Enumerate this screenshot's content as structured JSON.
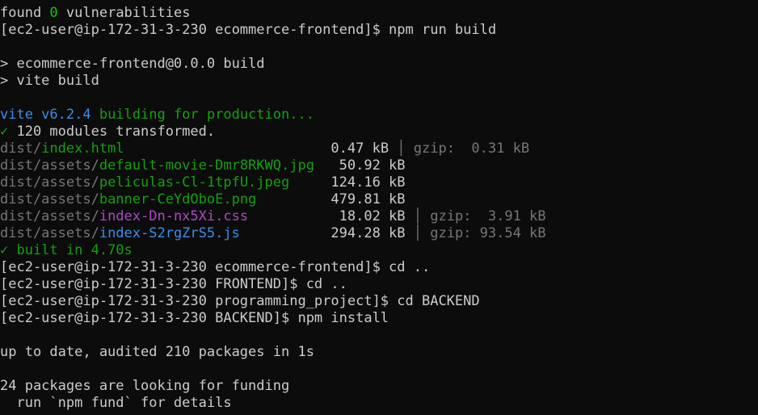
{
  "terminal": {
    "lines": [
      [
        {
          "t": "found ",
          "c": "white"
        },
        {
          "t": "0",
          "c": "bright-green"
        },
        {
          "t": " vulnerabilities",
          "c": "white"
        }
      ],
      [
        {
          "t": "[ec2-user@ip-172-31-3-230 ecommerce-frontend]$ npm run build",
          "c": "white"
        }
      ],
      [],
      [
        {
          "t": "> ecommerce-frontend@0.0.0 build",
          "c": "white"
        }
      ],
      [
        {
          "t": "> vite build",
          "c": "white"
        }
      ],
      [],
      [
        {
          "t": "vite v6.2.4",
          "c": "blue"
        },
        {
          "t": " building for production...",
          "c": "green"
        }
      ],
      [
        {
          "t": "✓",
          "c": "green"
        },
        {
          "t": " 120 modules transformed.",
          "c": "white"
        }
      ],
      [
        {
          "t": "dist/",
          "c": "gray"
        },
        {
          "t": "index.html",
          "c": "green"
        },
        {
          "t": "                         0.47 kB",
          "c": "white"
        },
        {
          "t": " │ gzip:  0.31 kB",
          "c": "gray"
        }
      ],
      [
        {
          "t": "dist/assets/",
          "c": "gray"
        },
        {
          "t": "default-movie-Dmr8RKWQ.jpg",
          "c": "green"
        },
        {
          "t": "   50.92 kB",
          "c": "white"
        }
      ],
      [
        {
          "t": "dist/assets/",
          "c": "gray"
        },
        {
          "t": "peliculas-Cl-1tpfU.jpeg",
          "c": "green"
        },
        {
          "t": "     124.16 kB",
          "c": "white"
        }
      ],
      [
        {
          "t": "dist/assets/",
          "c": "gray"
        },
        {
          "t": "banner-CeYdOboE.png",
          "c": "green"
        },
        {
          "t": "         479.81 kB",
          "c": "white"
        }
      ],
      [
        {
          "t": "dist/assets/",
          "c": "gray"
        },
        {
          "t": "index-Dn-nx5Xi.css",
          "c": "magenta"
        },
        {
          "t": "           18.02 kB",
          "c": "white"
        },
        {
          "t": " │ gzip:  3.91 kB",
          "c": "gray"
        }
      ],
      [
        {
          "t": "dist/assets/",
          "c": "gray"
        },
        {
          "t": "index-S2rgZrS5.js",
          "c": "blue"
        },
        {
          "t": "           294.28 kB",
          "c": "white"
        },
        {
          "t": " │ gzip: 93.54 kB",
          "c": "gray"
        }
      ],
      [
        {
          "t": "✓ built in 4.70s",
          "c": "green"
        }
      ],
      [
        {
          "t": "[ec2-user@ip-172-31-3-230 ecommerce-frontend]$ cd ..",
          "c": "white"
        }
      ],
      [
        {
          "t": "[ec2-user@ip-172-31-3-230 FRONTEND]$ cd ..",
          "c": "white"
        }
      ],
      [
        {
          "t": "[ec2-user@ip-172-31-3-230 programming_project]$ cd BACKEND",
          "c": "white"
        }
      ],
      [
        {
          "t": "[ec2-user@ip-172-31-3-230 BACKEND]$ npm install",
          "c": "white"
        }
      ],
      [],
      [
        {
          "t": "up to date, audited 210 packages in 1s",
          "c": "white"
        }
      ],
      [],
      [
        {
          "t": "24 packages are looking for funding",
          "c": "white"
        }
      ],
      [
        {
          "t": "  run `npm fund` for details",
          "c": "white"
        }
      ]
    ]
  }
}
